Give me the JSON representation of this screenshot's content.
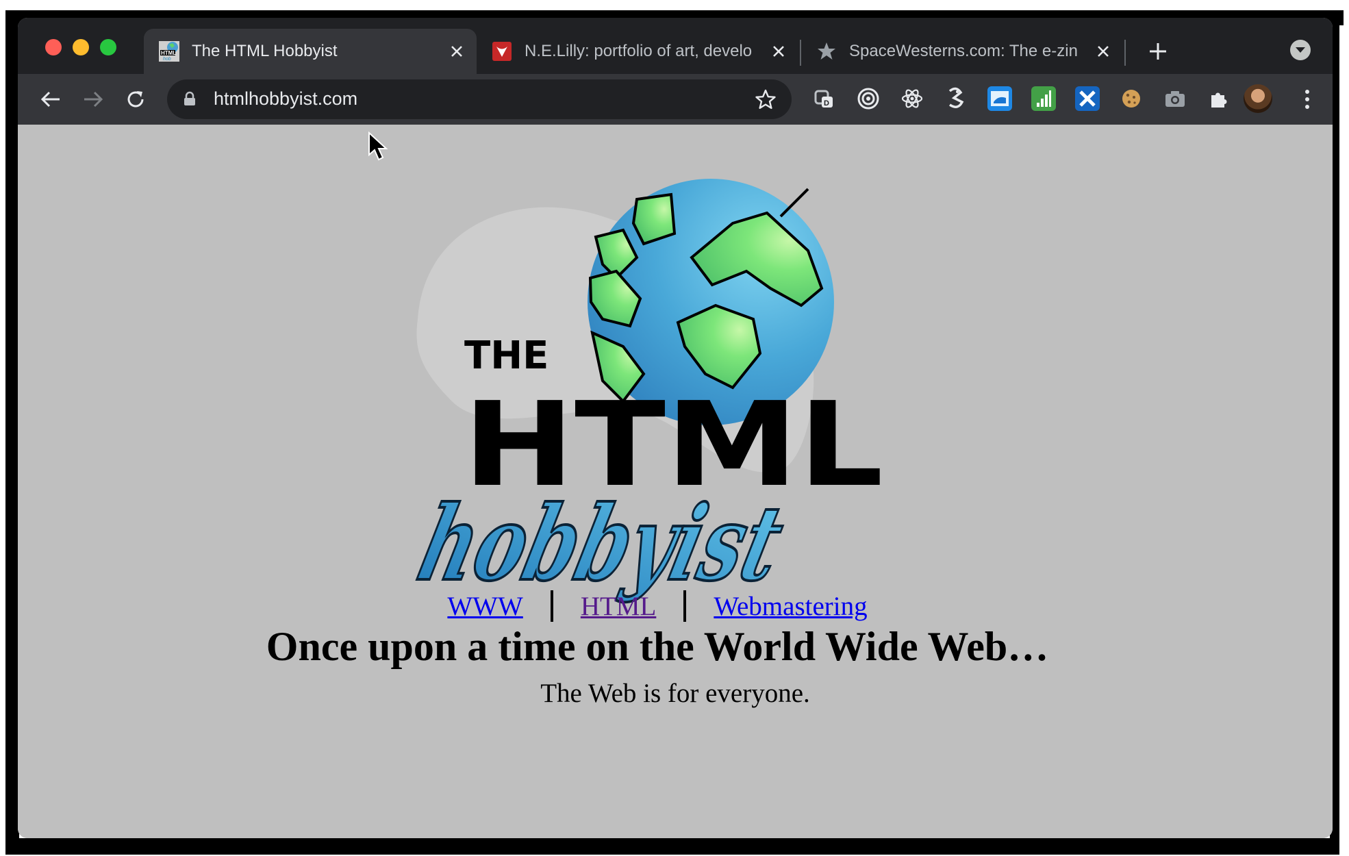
{
  "browser": {
    "tabs": [
      {
        "title": "The HTML Hobbyist",
        "active": true
      },
      {
        "title": "N.E.Lilly: portfolio of art, develo",
        "active": false
      },
      {
        "title": "SpaceWesterns.com: The e-zin",
        "active": false
      }
    ],
    "address": "htmlhobbyist.com",
    "extensions": [
      "tab-manager-icon",
      "target-icon",
      "react-devtools-icon",
      "wappalyzer-icon",
      "window-resizer-icon",
      "analytics-icon",
      "xcode-icon",
      "cookie-icon",
      "camera-icon",
      "puzzle-icon"
    ]
  },
  "page": {
    "logo": {
      "line1": "THE",
      "line2": "HTML",
      "line3": "hobbyist"
    },
    "tagline": "The Web is for everyone.",
    "nav": [
      {
        "label": "WWW"
      },
      {
        "label": "HTML"
      },
      {
        "label": "Webmastering"
      }
    ],
    "headline": "Once upon a time on the World Wide Web…"
  },
  "colors": {
    "link": "#0000ee",
    "visited": "#551a8b",
    "page_bg": "#bfbfbf",
    "chrome_dark": "#202124"
  }
}
